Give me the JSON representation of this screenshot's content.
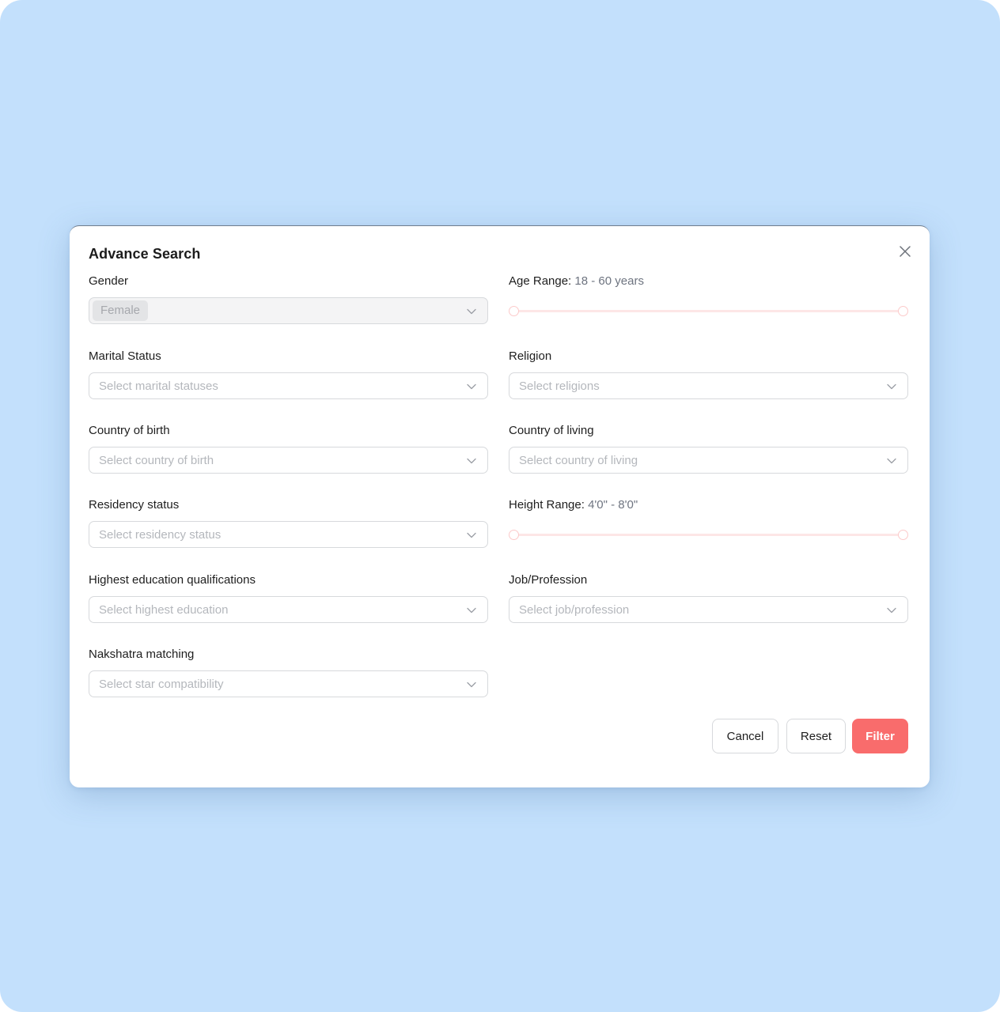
{
  "dialog": {
    "title": "Advance Search",
    "close_icon": "close-icon"
  },
  "fields": {
    "gender": {
      "label": "Gender",
      "value": "Female",
      "disabled": true
    },
    "age_range": {
      "label": "Age Range:",
      "value_text": "18 - 60 years",
      "min": 18,
      "max": 60,
      "selected_min": 18,
      "selected_max": 60
    },
    "marital_status": {
      "label": "Marital Status",
      "placeholder": "Select marital statuses"
    },
    "religion": {
      "label": "Religion",
      "placeholder": "Select religions"
    },
    "country_of_birth": {
      "label": "Country of birth",
      "placeholder": "Select country of birth"
    },
    "country_of_living": {
      "label": "Country of living",
      "placeholder": "Select country of living"
    },
    "residency_status": {
      "label": "Residency status",
      "placeholder": "Select residency status"
    },
    "height_range": {
      "label": "Height Range:",
      "value_text": "4'0\" - 8'0\""
    },
    "education": {
      "label": "Highest education qualifications",
      "placeholder": "Select highest education"
    },
    "job": {
      "label": "Job/Profession",
      "placeholder": "Select job/profession"
    },
    "nakshatra": {
      "label": "Nakshatra matching",
      "placeholder": "Select star compatibility"
    }
  },
  "actions": {
    "cancel": "Cancel",
    "reset": "Reset",
    "filter": "Filter"
  },
  "colors": {
    "background": "#c3e0fc",
    "primary": "#f96c6c",
    "slider_track": "#fde6e6",
    "slider_thumb_border": "#fccaca"
  }
}
